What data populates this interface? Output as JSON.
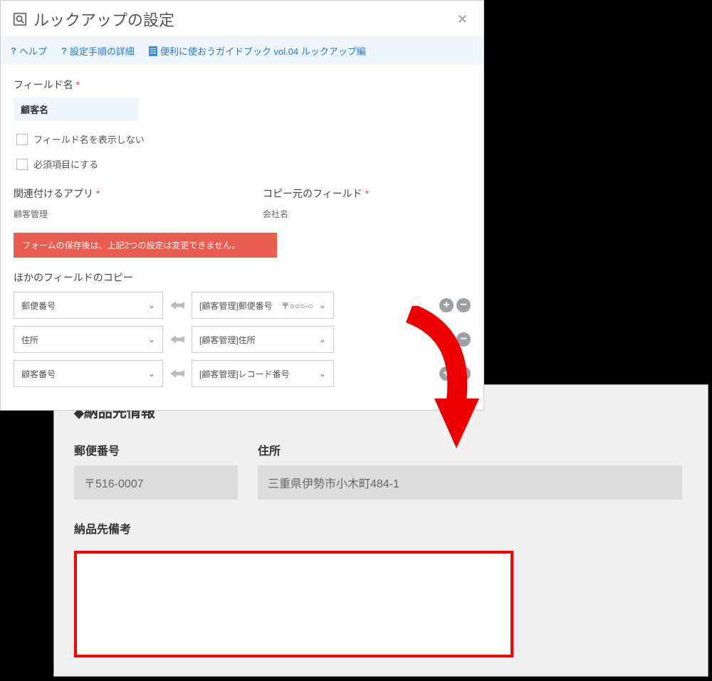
{
  "dialog": {
    "title": "ルックアップの設定",
    "help_links": {
      "help": "ヘルプ",
      "detail": "設定手順の詳細",
      "guide": "便利に使おうガイドブック vol.04 ルックアップ編"
    },
    "field_name_label": "フィールド名",
    "field_name_value": "顧客名",
    "hide_label_label": "フィールド名を表示しない",
    "required_label": "必須項目にする",
    "related_app_label": "関連付けるアプリ",
    "related_app_value": "顧客管理",
    "source_field_label": "コピー元のフィールド",
    "source_field_value": "会社名",
    "warning": "フォームの保存後は、上記2つの設定は変更できません。",
    "copy_section_label": "ほかのフィールドのコピー",
    "copy_rows": [
      {
        "target": "郵便番号",
        "source": "[顧客管理]郵便番号　〒○○○-○"
      },
      {
        "target": "住所",
        "source": "[顧客管理]住所"
      },
      {
        "target": "顧客番号",
        "source": "[顧客管理]レコード番号"
      }
    ]
  },
  "lower": {
    "title": "納品先情報",
    "zip_label": "郵便番号",
    "zip_value": "〒516-0007",
    "addr_label": "住所",
    "addr_value": "三重県伊勢市小木町484-1",
    "memo_label": "納品先備考"
  }
}
